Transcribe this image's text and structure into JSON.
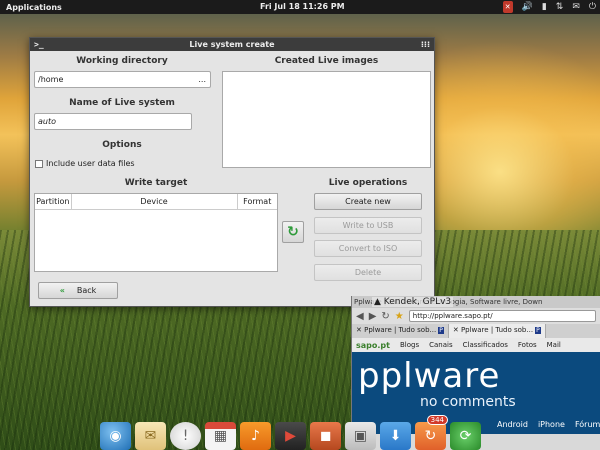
{
  "top_panel": {
    "applications": "Applications",
    "clock": "Fri Jul 18 11:26 PM",
    "tray_icons": [
      "close-x-icon",
      "volume-icon",
      "battery-icon",
      "network-icon",
      "settings-icon",
      "power-icon"
    ]
  },
  "window": {
    "title": "Live system create",
    "working_directory": {
      "label": "Working directory",
      "value": "/home",
      "browse": "..."
    },
    "live_system_name": {
      "label": "Name of Live system",
      "value": "auto"
    },
    "options": {
      "label": "Options",
      "include_user_data": "Include user data files",
      "checked": false
    },
    "created_images": {
      "label": "Created Live images",
      "items": []
    },
    "write_target": {
      "label": "Write target",
      "columns": [
        "Partition",
        "Device",
        "Format"
      ],
      "rows": []
    },
    "operations": {
      "label": "Live operations",
      "create_new": "Create new",
      "write_to_usb": "Write to USB",
      "convert_to_iso": "Convert to ISO",
      "delete": "Delete"
    },
    "back": "Back"
  },
  "tooltip": "Kendek, GPLv3",
  "browser": {
    "title": "Pplware | Tudo sobre Tecnologia, Software livre, Down",
    "url": "http://pplware.sapo.pt/",
    "tabs": [
      "Pplware | Tudo sob...",
      "Pplware | Tudo sob..."
    ],
    "sapo_logo": "sapo.pt",
    "sapo_links": [
      "Blogs",
      "Canais",
      "Classificados",
      "Fotos",
      "Mail"
    ],
    "banner_main": "pplware",
    "banner_sub": "no comments",
    "nav_links": [
      "Android",
      "iPhone",
      "Fórum",
      "V"
    ]
  },
  "dock": {
    "badge_count": "344",
    "icons": [
      "web-browser-icon",
      "mail-icon",
      "chat-icon",
      "calendar-icon",
      "music-icon",
      "video-icon",
      "photos-icon",
      "windows-icon",
      "downloads-icon",
      "updates-icon",
      "sync-icon"
    ]
  }
}
